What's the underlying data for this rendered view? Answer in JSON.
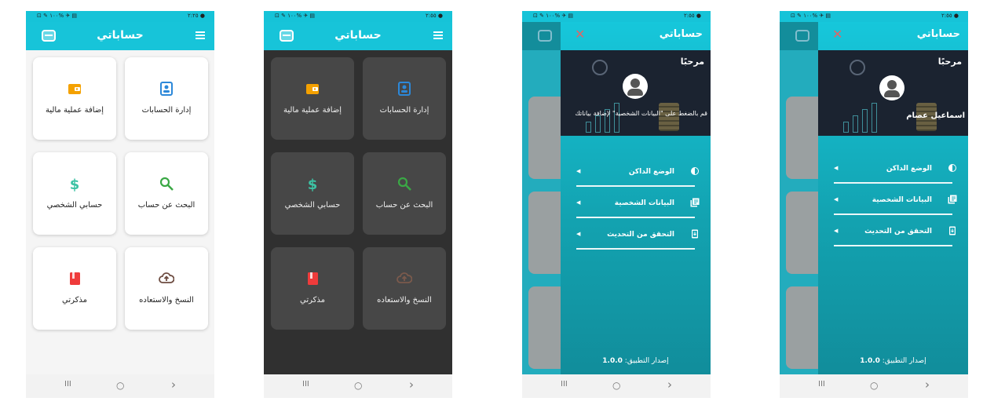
{
  "app": {
    "title": "حساباتي",
    "status_left": "⊡ ✎ ١٠٠% ✈ ▤",
    "status_right": "٢:٢٥ ●",
    "status_right_2": "٢:٥٥ ●"
  },
  "home": {
    "cards": [
      {
        "label": "إدارة الحسابات",
        "icon": "account-card-icon"
      },
      {
        "label": "إضافة عملية مالية",
        "icon": "wallet-icon"
      },
      {
        "label": "البحث عن حساب",
        "icon": "search-icon"
      },
      {
        "label": "حسابي الشخصي",
        "icon": "dollar-icon"
      },
      {
        "label": "النسخ والاستعاده",
        "icon": "cloud-upload-icon"
      },
      {
        "label": "مذكرتي",
        "icon": "notebook-icon"
      }
    ]
  },
  "drawer": {
    "title": "حساباتي",
    "greeting": "مرحبًا",
    "prompt": "قم بالضغط على \"البيانات الشخصية\" لإضافة بياناتك",
    "user_name": "اسماعيل عصام",
    "items": [
      {
        "label": "الوضع الداكن",
        "icon": "brightness-icon"
      },
      {
        "label": "البيانات الشخصية",
        "icon": "library-books-icon"
      },
      {
        "label": "التحقق من التحديث",
        "icon": "system-update-icon"
      }
    ],
    "version_label": "إصدار التطبيق:",
    "version_value": "1.0.0"
  },
  "navbar": {
    "recent": "III",
    "home": "○",
    "back": "›"
  },
  "colors": {
    "accent": "#17c4d9",
    "dark_bg": "#303030",
    "light_bg": "#f5f5f5"
  }
}
